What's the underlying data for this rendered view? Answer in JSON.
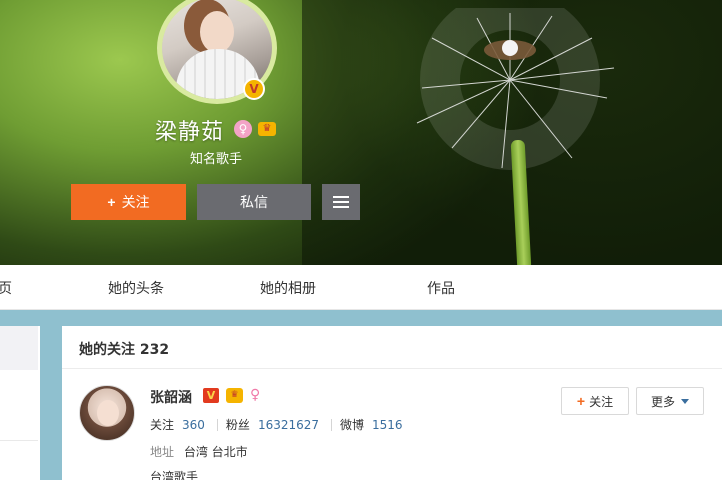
{
  "profile": {
    "name": "梁静茹",
    "subtitle": "知名歌手",
    "verified_badge": "V",
    "follow_label": "关注",
    "message_label": "私信"
  },
  "tabs": [
    {
      "label": "页"
    },
    {
      "label": "她的头条"
    },
    {
      "label": "她的相册"
    },
    {
      "label": "作品"
    }
  ],
  "following_card": {
    "title": "她的关注 232",
    "user": {
      "name": "张韶涵",
      "verified_badge": "V",
      "stats": [
        {
          "label": "关注",
          "value": "360"
        },
        {
          "label": "粉丝",
          "value": "16321627"
        },
        {
          "label": "微博",
          "value": "1516"
        }
      ],
      "address_label": "地址",
      "address_value": "台湾 台北市",
      "description": "台湾歌手",
      "follow_label": "关注",
      "more_label": "更多"
    }
  },
  "colors": {
    "follow_button": "#f26b22",
    "secondary_button": "#6a6b70",
    "link_blue": "#3a6e9e",
    "page_bg": "#8fc0cf"
  },
  "icons": [
    "plus-icon",
    "menu-icon",
    "verified-v-icon",
    "female-icon",
    "crown-icon",
    "caret-down-icon"
  ]
}
